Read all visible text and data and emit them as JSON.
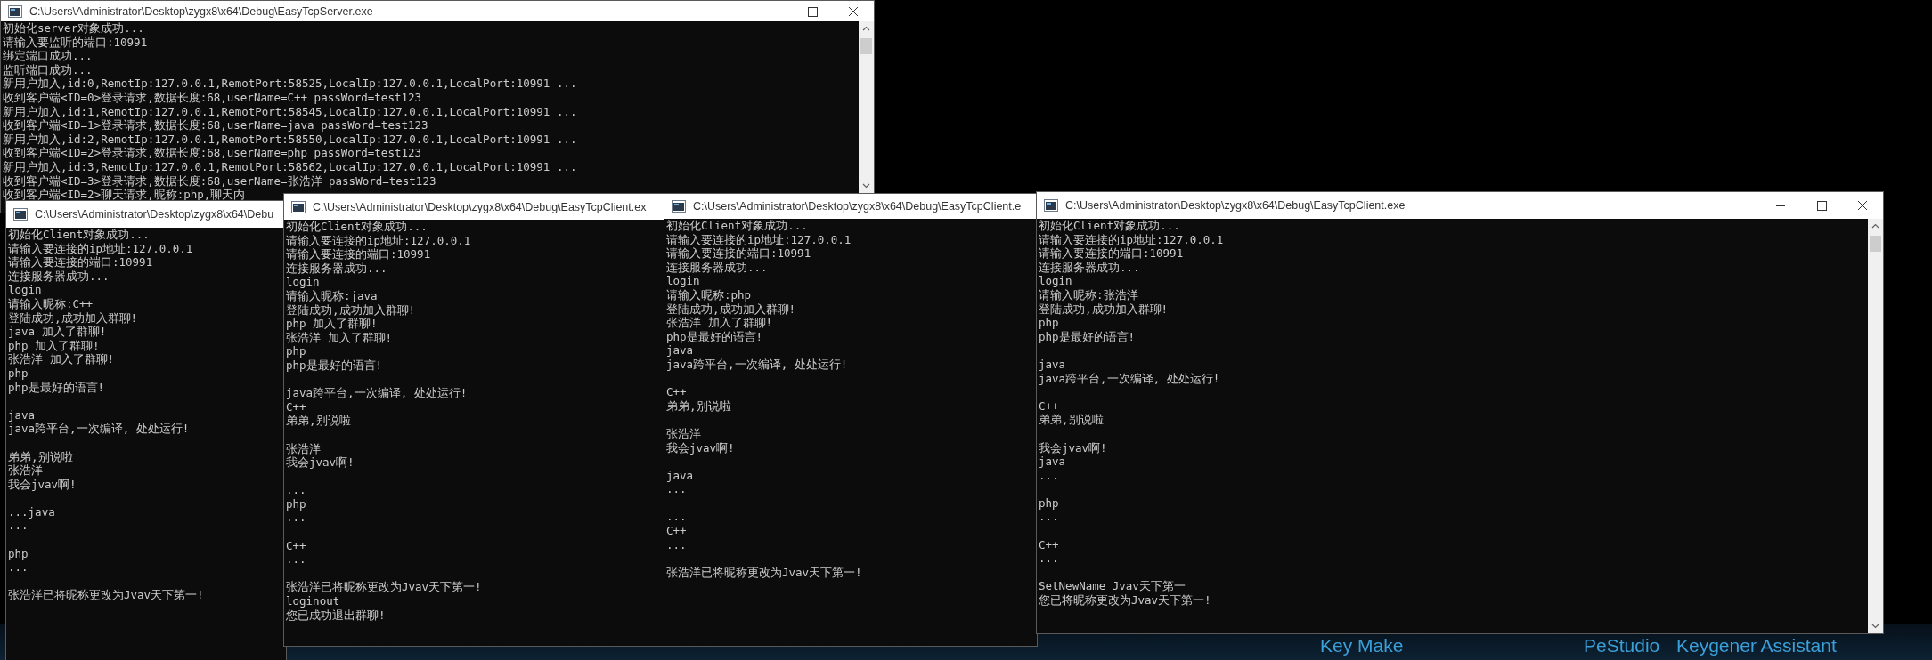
{
  "windows": [
    {
      "title": "C:\\Users\\Administrator\\Desktop\\zygx8\\x64\\Debug\\EasyTcpServer.exe",
      "caption_buttons": true,
      "scrollbar": true,
      "blocks": [
        {
          "lines": [
            "初始化server对象成功...",
            "请输入要监听的端口:10991",
            "绑定端口成功...",
            "监听端口成功...",
            "新用户加入,id:0,RemotIp:127.0.0.1,RemotPort:58525,LocalIp:127.0.0.1,LocalPort:10991 ...",
            "收到客户端<ID=0>登录请求,数据长度:68,userName=C++ passWord=test123",
            "新用户加入,id:1,RemotIp:127.0.0.1,RemotPort:58545,LocalIp:127.0.0.1,LocalPort:10991 ...",
            "收到客户端<ID=1>登录请求,数据长度:68,userName=java passWord=test123",
            "新用户加入,id:2,RemotIp:127.0.0.1,RemotPort:58550,LocalIp:127.0.0.1,LocalPort:10991 ...",
            "收到客户端<ID=2>登录请求,数据长度:68,userName=php passWord=test123",
            "新用户加入,id:3,RemotIp:127.0.0.1,RemotPort:58562,LocalIp:127.0.0.1,LocalPort:10991 ...",
            "收到客户端<ID=3>登录请求,数据长度:68,userName=张浩洋 passWord=test123",
            "收到客户端<ID=2>聊天请求,昵称:php,聊天内"
          ]
        }
      ]
    },
    {
      "title": "C:\\Users\\Administrator\\Desktop\\zygx8\\x64\\Debu",
      "blocks": [
        {
          "lines": [
            "初始化Client对象成功...",
            "请输入要连接的ip地址:127.0.0.1",
            "请输入要连接的端口:10991",
            "连接服务器成功...",
            "login",
            "请输入昵称:C++",
            "登陆成功,成功加入群聊!",
            "java 加入了群聊!",
            "php 加入了群聊!",
            "张浩洋 加入了群聊!",
            "php",
            "php是最好的语言!"
          ]
        },
        {
          "lines": [
            "java",
            "java跨平台,一次编译, 处处运行!"
          ]
        },
        {
          "lines": [
            "弟弟,别说啦",
            "张浩洋",
            "我会jvav啊!"
          ]
        },
        {
          "lines": [
            "...java",
            "..."
          ]
        },
        {
          "lines": [
            "php",
            "..."
          ]
        },
        {
          "lines": [
            "张浩洋已将昵称更改为Jvav天下第一!"
          ]
        }
      ]
    },
    {
      "title": "C:\\Users\\Administrator\\Desktop\\zygx8\\x64\\Debug\\EasyTcpClient.ex",
      "blocks": [
        {
          "lines": [
            "初始化Client对象成功...",
            "请输入要连接的ip地址:127.0.0.1",
            "请输入要连接的端口:10991",
            "连接服务器成功...",
            "login",
            "请输入昵称:java",
            "登陆成功,成功加入群聊!",
            "php 加入了群聊!",
            "张浩洋 加入了群聊!",
            "php",
            "php是最好的语言!"
          ]
        },
        {
          "lines": [
            "java跨平台,一次编译, 处处运行!",
            "C++",
            "弟弟,别说啦"
          ]
        },
        {
          "lines": [
            "张浩洋",
            "我会jvav啊!"
          ]
        },
        {
          "lines": [
            "...",
            "php",
            "..."
          ]
        },
        {
          "lines": [
            "C++",
            "..."
          ]
        },
        {
          "lines": [
            "张浩洋已将昵称更改为Jvav天下第一!",
            "loginout",
            "您已成功退出群聊!"
          ]
        }
      ]
    },
    {
      "title": "C:\\Users\\Administrator\\Desktop\\zygx8\\x64\\Debug\\EasyTcpClient.e",
      "blocks": [
        {
          "lines": [
            "初始化Client对象成功...",
            "请输入要连接的ip地址:127.0.0.1",
            "请输入要连接的端口:10991",
            "连接服务器成功...",
            "login",
            "请输入昵称:php",
            "登陆成功,成功加入群聊!",
            "张浩洋 加入了群聊!",
            "php是最好的语言!",
            "java",
            "java跨平台,一次编译, 处处运行!"
          ]
        },
        {
          "lines": [
            "C++",
            "弟弟,别说啦"
          ]
        },
        {
          "lines": [
            "张浩洋",
            "我会jvav啊!"
          ]
        },
        {
          "lines": [
            "java",
            "..."
          ]
        },
        {
          "lines": [
            "...",
            "C++",
            "..."
          ]
        },
        {
          "lines": [
            "张浩洋已将昵称更改为Jvav天下第一!"
          ]
        }
      ]
    },
    {
      "title": "C:\\Users\\Administrator\\Desktop\\zygx8\\x64\\Debug\\EasyTcpClient.exe",
      "caption_buttons": true,
      "scrollbar": true,
      "blocks": [
        {
          "lines": [
            "初始化Client对象成功...",
            "请输入要连接的ip地址:127.0.0.1",
            "请输入要连接的端口:10991",
            "连接服务器成功...",
            "login",
            "请输入昵称:张浩洋",
            "登陆成功,成功加入群聊!",
            "php",
            "php是最好的语言!"
          ]
        },
        {
          "lines": [
            "java",
            "java跨平台,一次编译, 处处运行!"
          ]
        },
        {
          "lines": [
            "C++",
            "弟弟,别说啦"
          ]
        },
        {
          "lines": [
            "我会jvav啊!",
            "java",
            "..."
          ]
        },
        {
          "lines": [
            "php",
            "..."
          ]
        },
        {
          "lines": [
            "C++",
            "..."
          ]
        },
        {
          "lines": [
            "SetNewName Jvav天下第一",
            "您已将昵称更改为Jvav天下第一!"
          ]
        }
      ]
    }
  ],
  "desktop_icons": [
    {
      "label": "Key Make"
    },
    {
      "label": "PeStudio"
    },
    {
      "label": "Keygener Assistant"
    }
  ]
}
